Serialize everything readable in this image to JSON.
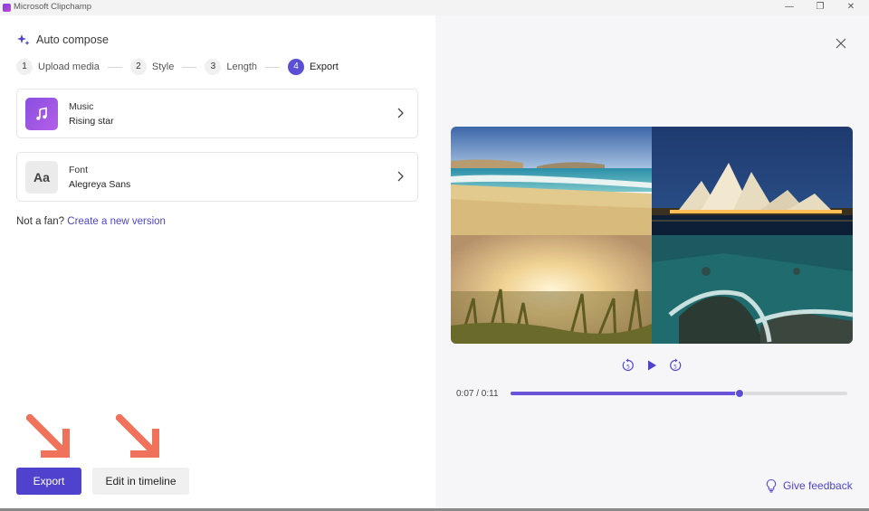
{
  "window": {
    "title": "Microsoft Clipchamp",
    "minimize_glyph": "—",
    "maximize_glyph": "❐",
    "close_glyph": "✕"
  },
  "header": {
    "title": "Auto compose",
    "icon": "sparkle-icon"
  },
  "steps": [
    {
      "number": "1",
      "label": "Upload media",
      "active": false
    },
    {
      "number": "2",
      "label": "Style",
      "active": false
    },
    {
      "number": "3",
      "label": "Length",
      "active": false
    },
    {
      "number": "4",
      "label": "Export",
      "active": true
    }
  ],
  "cards": {
    "music": {
      "label": "Music",
      "value": "Rising star",
      "icon": "music-note-icon"
    },
    "font": {
      "label": "Font",
      "value": "Alegreya Sans",
      "thumb_text": "Aa"
    }
  },
  "not_a_fan": {
    "text": "Not a fan?",
    "link": "Create a new version"
  },
  "actions": {
    "export_label": "Export",
    "timeline_label": "Edit in timeline"
  },
  "preview": {
    "tiles": [
      "beach-scene",
      "opera-house-night",
      "sunset-grass",
      "aerial-coastline"
    ]
  },
  "playback": {
    "current": "0:07",
    "total": "0:11",
    "readout": "0:07 / 0:11",
    "progress": 0.68
  },
  "feedback": {
    "label": "Give feedback"
  },
  "colors": {
    "accent": "#4f42cc",
    "link": "#4f46c8",
    "arrow": "#f0725a"
  }
}
